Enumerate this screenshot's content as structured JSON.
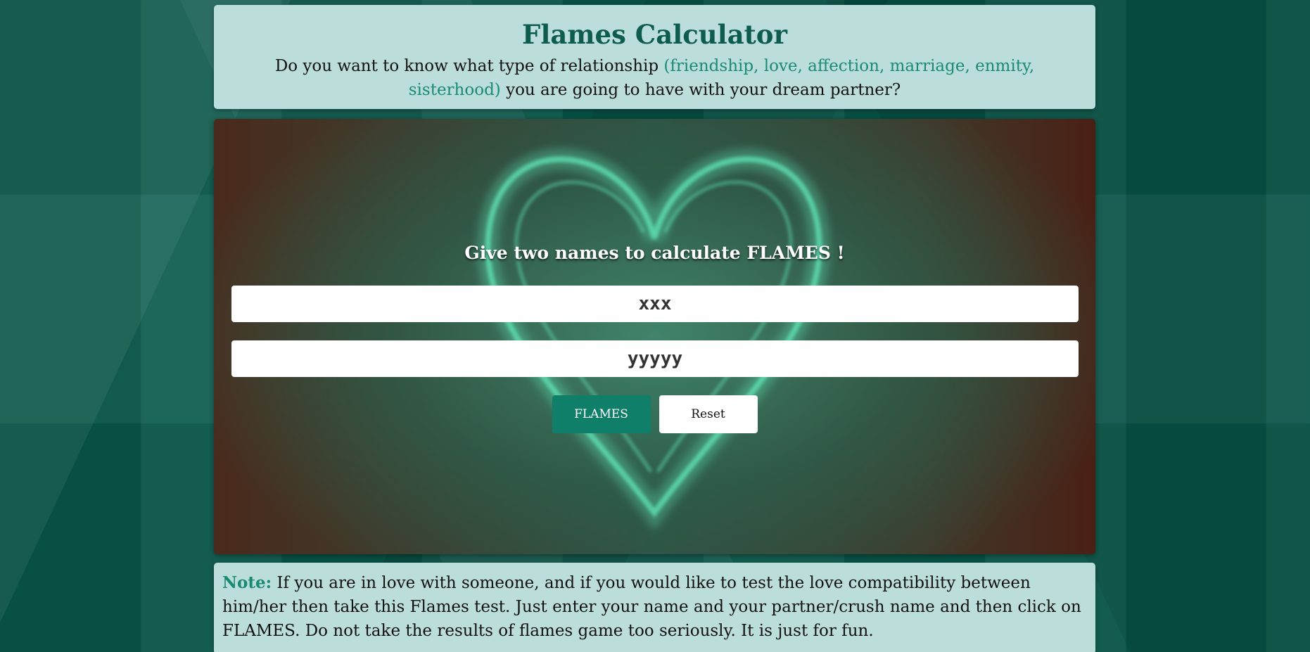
{
  "header": {
    "title": "Flames Calculator",
    "intro_before": "Do you want to know what type of relationship ",
    "intro_accent": "(friendship, love, affection, marriage, enmity, sisterhood)",
    "intro_after": " you are going to have with your dream partner?"
  },
  "form": {
    "prompt": "Give two names to calculate FLAMES !",
    "name1_value": "xxx",
    "name2_value": "yyyyy",
    "flames_label": "FLAMES",
    "reset_label": "Reset"
  },
  "note": {
    "label": "Note:",
    "text": " If you are in love with someone, and if you would like to test the love compatibility between him/her then take this Flames test. Just enter your name and your partner/crush name and then click on FLAMES. Do not take the results of flames game too seriously. It is just for fun."
  },
  "colors": {
    "accent": "#1a8a72",
    "title": "#0e5c4c",
    "card_bg": "#bcdeda",
    "button_primary": "#0f7f69"
  },
  "icons": {
    "hero": "smoke-heart-image"
  }
}
